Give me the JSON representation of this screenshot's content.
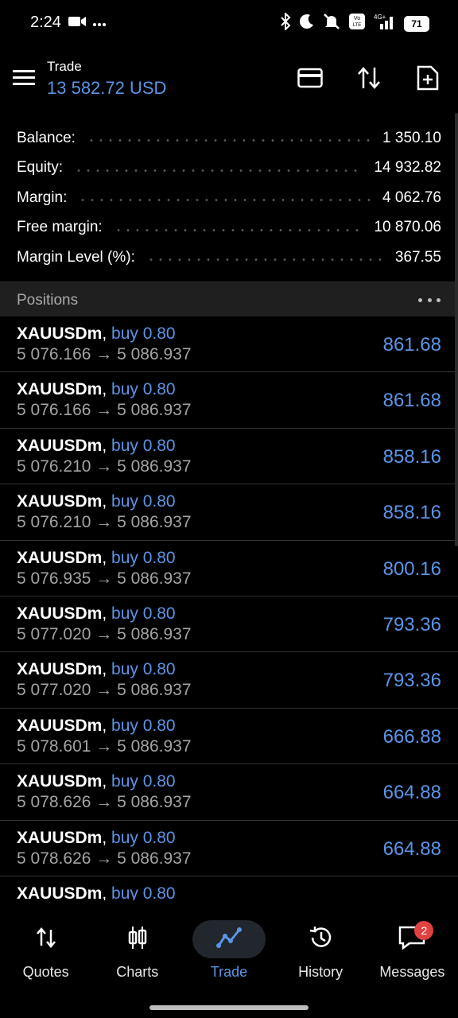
{
  "status_bar": {
    "time": "2:24",
    "battery": "71"
  },
  "header": {
    "title": "Trade",
    "subtitle": "13 582.72 USD"
  },
  "summary": [
    {
      "label": "Balance:",
      "value": "1 350.10"
    },
    {
      "label": "Equity:",
      "value": "14 932.82"
    },
    {
      "label": "Margin:",
      "value": "4 062.76"
    },
    {
      "label": "Free margin:",
      "value": "10 870.06"
    },
    {
      "label": "Margin Level (%):",
      "value": "367.55"
    }
  ],
  "positions": {
    "title": "Positions",
    "rows": [
      {
        "symbol": "XAUUSDm",
        "side": "buy 0.80",
        "prices": "5 076.166 → 5 086.937",
        "profit": "861.68"
      },
      {
        "symbol": "XAUUSDm",
        "side": "buy 0.80",
        "prices": "5 076.166 → 5 086.937",
        "profit": "861.68"
      },
      {
        "symbol": "XAUUSDm",
        "side": "buy 0.80",
        "prices": "5 076.210 → 5 086.937",
        "profit": "858.16"
      },
      {
        "symbol": "XAUUSDm",
        "side": "buy 0.80",
        "prices": "5 076.210 → 5 086.937",
        "profit": "858.16"
      },
      {
        "symbol": "XAUUSDm",
        "side": "buy 0.80",
        "prices": "5 076.935 → 5 086.937",
        "profit": "800.16"
      },
      {
        "symbol": "XAUUSDm",
        "side": "buy 0.80",
        "prices": "5 077.020 → 5 086.937",
        "profit": "793.36"
      },
      {
        "symbol": "XAUUSDm",
        "side": "buy 0.80",
        "prices": "5 077.020 → 5 086.937",
        "profit": "793.36"
      },
      {
        "symbol": "XAUUSDm",
        "side": "buy 0.80",
        "prices": "5 078.601 → 5 086.937",
        "profit": "666.88"
      },
      {
        "symbol": "XAUUSDm",
        "side": "buy 0.80",
        "prices": "5 078.626 → 5 086.937",
        "profit": "664.88"
      },
      {
        "symbol": "XAUUSDm",
        "side": "buy 0.80",
        "prices": "5 078.626 → 5 086.937",
        "profit": "664.88"
      },
      {
        "symbol": "XAUUSDm",
        "side": "buy 0.80",
        "prices": "",
        "profit": ""
      }
    ]
  },
  "nav": {
    "items": [
      {
        "label": "Quotes",
        "icon": "quotes-icon"
      },
      {
        "label": "Charts",
        "icon": "charts-icon"
      },
      {
        "label": "Trade",
        "icon": "trade-icon",
        "active": true
      },
      {
        "label": "History",
        "icon": "history-icon"
      },
      {
        "label": "Messages",
        "icon": "messages-icon",
        "badge": "2"
      }
    ]
  },
  "colors": {
    "accent": "#5a95e6",
    "background": "#000000",
    "section_header": "#1f1f1f",
    "badge": "#e04242"
  }
}
